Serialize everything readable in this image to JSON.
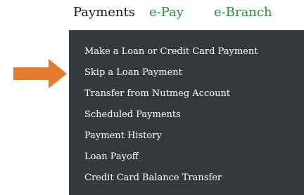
{
  "nav": {
    "items": [
      {
        "label": "Payments"
      },
      {
        "label": "e-Pay"
      },
      {
        "label": "e-Branch"
      }
    ]
  },
  "menu": {
    "items": [
      {
        "label": "Make a Loan or Credit Card Payment"
      },
      {
        "label": "Skip a Loan Payment"
      },
      {
        "label": "Transfer from Nutmeg Account"
      },
      {
        "label": "Scheduled Payments"
      },
      {
        "label": "Payment History"
      },
      {
        "label": "Loan Payoff"
      },
      {
        "label": "Credit Card Balance Transfer"
      }
    ]
  },
  "colors": {
    "nav_active": "#1a1a1a",
    "nav_link": "#2e8b3c",
    "menu_bg": "#35393c",
    "menu_text": "#ffffff",
    "arrow": "#e87a2e"
  },
  "icons": {
    "pointer": "arrow-right-icon"
  }
}
